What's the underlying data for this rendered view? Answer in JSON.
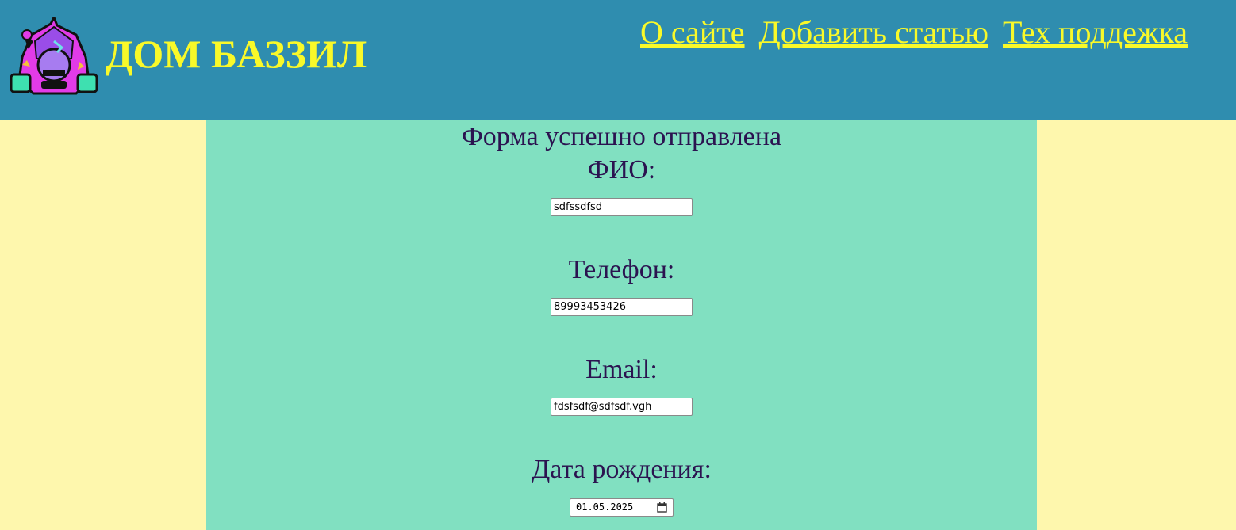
{
  "site": {
    "title": "ДОМ БАЗЗИЛ",
    "logo_icon": "wizard-mascot-logo-icon"
  },
  "nav": {
    "items": [
      {
        "label": "О сайте"
      },
      {
        "label": "Добавить статью"
      },
      {
        "label": "Тех поддежка"
      }
    ]
  },
  "form": {
    "status": "Форма успешно отправлена",
    "fio_label": "ФИО:",
    "fio_value": "sdfssdfsd",
    "phone_label": "Телефон:",
    "phone_value": "89993453426",
    "email_label": "Email:",
    "email_value": "fdsfsdf@sdfsdf.vgh",
    "birth_label": "Дата рождения:",
    "birth_value": "01.05.2025",
    "calendar_icon": "calendar-icon"
  },
  "colors": {
    "header_bg": "#2f8daf",
    "accent_yellow": "#f9f929",
    "page_bg": "#fef7ad",
    "main_bg": "#81e0c1",
    "text_dark": "#2b1350"
  }
}
